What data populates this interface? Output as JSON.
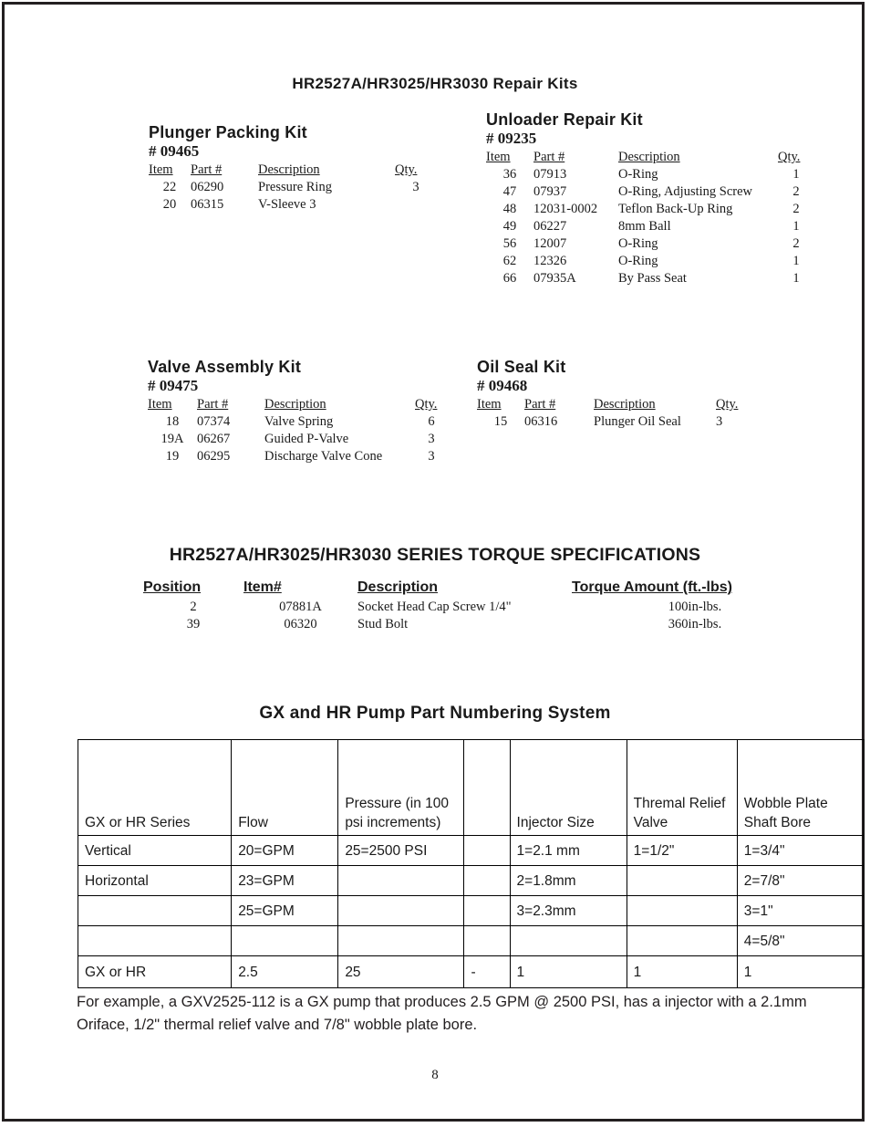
{
  "page": {
    "title": "HR2527A/HR3025/HR3030 Repair Kits",
    "number": "8"
  },
  "kits": [
    {
      "name": "Plunger Packing Kit",
      "kit_number": "# 09465",
      "columns": [
        "Item",
        "Part #",
        "Description",
        "Qty."
      ],
      "rows": [
        [
          "22",
          "06290",
          "Pressure Ring",
          "3"
        ],
        [
          "20",
          "06315",
          "V-Sleeve   3",
          ""
        ]
      ]
    },
    {
      "name": "Unloader Repair Kit",
      "kit_number": "# 09235",
      "columns": [
        "Item",
        "Part #",
        "Description",
        "Qty."
      ],
      "rows": [
        [
          "36",
          "07913",
          "O-Ring",
          "1"
        ],
        [
          "47",
          "07937",
          "O-Ring, Adjusting Screw",
          "2"
        ],
        [
          "48",
          "12031-0002",
          "Teflon Back-Up Ring",
          "2"
        ],
        [
          "49",
          "06227",
          "8mm Ball",
          "1"
        ],
        [
          "56",
          "12007",
          "O-Ring",
          "2"
        ],
        [
          "62",
          "12326",
          "O-Ring",
          "1"
        ],
        [
          "66",
          "07935A",
          "By Pass Seat",
          "1"
        ]
      ]
    },
    {
      "name": "Valve Assembly Kit",
      "kit_number": "# 09475",
      "columns": [
        "Item",
        "Part #",
        "Description",
        "Qty."
      ],
      "rows": [
        [
          "18",
          "07374",
          "Valve Spring",
          "6"
        ],
        [
          "19A",
          "06267",
          "Guided P-Valve",
          "3"
        ],
        [
          "19",
          "06295",
          "Discharge Valve Cone",
          "3"
        ]
      ]
    },
    {
      "name": "Oil Seal Kit",
      "kit_number": "# 09468",
      "columns": [
        "Item",
        "Part #",
        "Description",
        "Qty."
      ],
      "rows": [
        [
          "15",
          "06316",
          "Plunger Oil Seal",
          "3"
        ]
      ]
    }
  ],
  "torque": {
    "title": "HR2527A/HR3025/HR3030  SERIES  TORQUE  SPECIFICATIONS",
    "columns": [
      "Position",
      "Item#",
      "Description",
      "Torque Amount (ft.-lbs)"
    ],
    "rows": [
      [
        "2",
        "07881A",
        "Socket Head Cap Screw 1/4\"",
        "100in-lbs."
      ],
      [
        "39",
        "06320",
        "Stud Bolt",
        "360in-lbs."
      ]
    ]
  },
  "numbering": {
    "title": "GX and HR Pump Part Numbering System",
    "headers": [
      "GX or HR Series",
      "Flow",
      "Pressure (in 100 psi increments)",
      "",
      "Injector Size",
      "Thremal Relief Valve",
      "Wobble Plate Shaft Bore"
    ],
    "rows": [
      [
        "Vertical",
        "20=GPM",
        "25=2500 PSI",
        "",
        "1=2.1 mm",
        "1=1/2\"",
        "1=3/4\""
      ],
      [
        "Horizontal",
        "23=GPM",
        "",
        "",
        "2=1.8mm",
        "",
        "2=7/8\""
      ],
      [
        "",
        "25=GPM",
        "",
        "",
        "3=2.3mm",
        "",
        "3=1\""
      ],
      [
        "",
        "",
        "",
        "",
        "",
        "",
        "4=5/8\""
      ],
      [
        "GX or HR",
        "2.5",
        "25",
        "-",
        "1",
        "1",
        "1"
      ]
    ]
  },
  "example": {
    "text": "For example, a GXV2525-112 is a GX pump that produces 2.5 GPM @ 2500 PSI, has a injector with a 2.1mm Oriface, 1/2\" thermal relief valve and 7/8\" wobble plate bore."
  }
}
